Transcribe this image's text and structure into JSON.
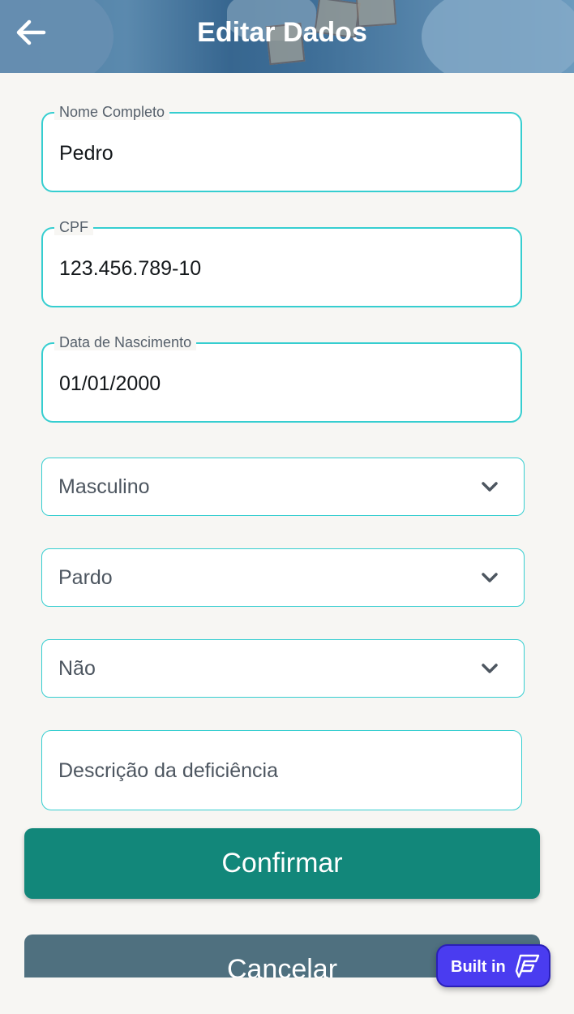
{
  "header": {
    "title": "Editar Dados",
    "back_icon": "arrow-left-icon"
  },
  "form": {
    "nome": {
      "label": "Nome Completo",
      "value": "Pedro"
    },
    "cpf": {
      "label": "CPF",
      "value": "123.456.789-10"
    },
    "nascimento": {
      "label": "Data de Nascimento",
      "value": "01/01/2000"
    },
    "sexo": {
      "value": "Masculino",
      "icon": "chevron-down-icon"
    },
    "raca": {
      "value": "Pardo",
      "icon": "chevron-down-icon"
    },
    "deficiencia": {
      "value": "Não",
      "icon": "chevron-down-icon"
    },
    "descricao": {
      "placeholder": "Descrição da deficiência"
    }
  },
  "actions": {
    "confirm_label": "Confirmar",
    "cancel_label": "Cancelar"
  },
  "badge": {
    "label": "Built in",
    "icon": "flutterflow-logo-icon"
  },
  "colors": {
    "accent_border": "#36ced0",
    "confirm": "#12877a",
    "cancel": "#4f707f",
    "badge": "#4a3cf0",
    "background": "#f7f6f3"
  }
}
